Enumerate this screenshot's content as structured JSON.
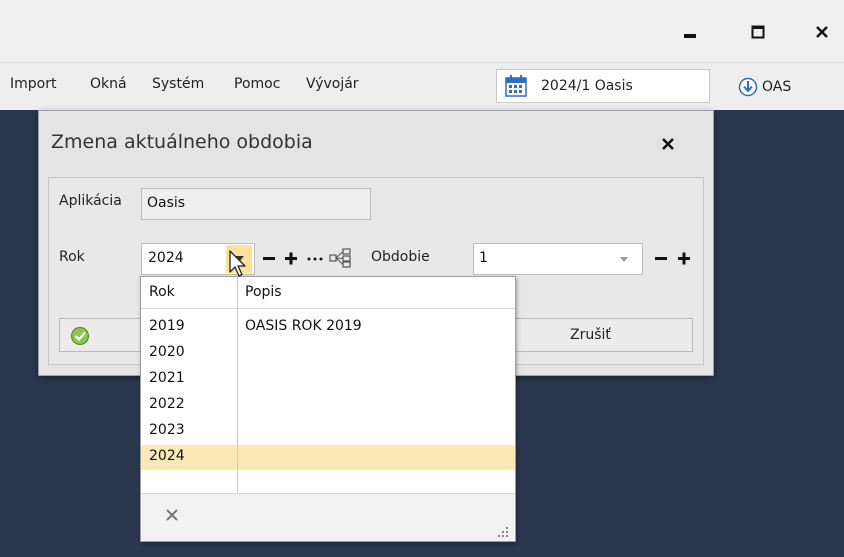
{
  "window": {
    "minimize_glyph": "▬",
    "maximize_glyph": "☐",
    "close_glyph": "✕"
  },
  "menu": {
    "items": [
      "Import",
      "Okná",
      "Systém",
      "Pomoc",
      "Vývojár"
    ],
    "period": "2024/1 Oasis",
    "user": "OAS"
  },
  "dialog": {
    "title": "Zmena aktuálneho obdobia",
    "close_glyph": "✕",
    "application_label": "Aplikácia",
    "application_value": "Oasis",
    "year_label": "Rok",
    "year_value": "2024",
    "period_label": "Obdobie",
    "period_value": "1",
    "cancel_label": "Zrušiť"
  },
  "dropdown": {
    "columns": [
      "Rok",
      "Popis"
    ],
    "rows": [
      {
        "year": "2019",
        "description": "OASIS ROK 2019"
      },
      {
        "year": "2020",
        "description": ""
      },
      {
        "year": "2021",
        "description": ""
      },
      {
        "year": "2022",
        "description": ""
      },
      {
        "year": "2023",
        "description": ""
      },
      {
        "year": "2024",
        "description": ""
      }
    ],
    "selected_year": "2024",
    "clear_glyph": "✕"
  },
  "colors": {
    "workspace": "#2a374f",
    "selection": "#fbe8b4",
    "accent_blue": "#2f6fc0",
    "ok_green": "#6aa832"
  }
}
